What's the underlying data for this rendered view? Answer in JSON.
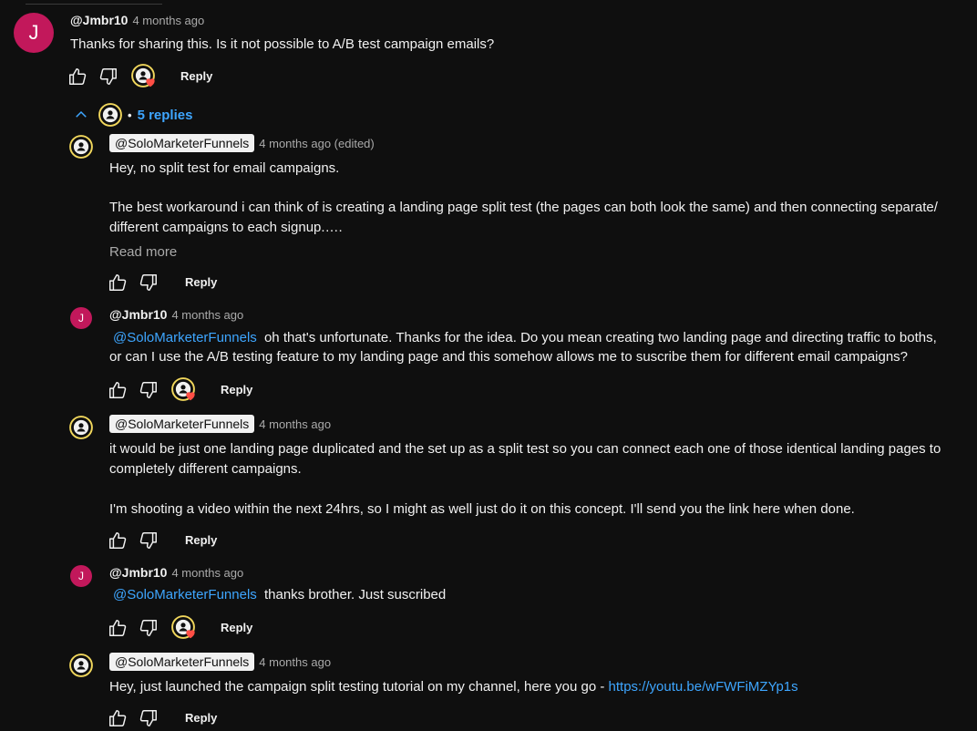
{
  "comment": {
    "avatar_letter": "J",
    "author": "@Jmbr10",
    "time": "4 months ago",
    "text": "Thanks for sharing this. Is it not possible to A/B test campaign emails?",
    "reply_label": "Reply"
  },
  "replies_toggle": {
    "dot": "•",
    "label": "5 replies"
  },
  "replies": [
    {
      "author": "@SoloMarketerFunnels",
      "time": "4 months ago (edited)",
      "line1": "Hey, no split test for email campaigns.",
      "line2": "The best workaround i can think of is creating a landing page split test (the pages can both look the same) and then connecting separate/",
      "line3": "different campaigns to each signup.….",
      "read_more": "Read more",
      "reply_label": "Reply"
    },
    {
      "avatar_letter": "J",
      "author": "@Jmbr10",
      "time": "4 months ago",
      "mention": "@SoloMarketerFunnels",
      "line1": "oh that's unfortunate. Thanks for the idea. Do you mean creating two landing page and directing traffic to boths,",
      "line2": "or can I use the A/B testing feature to my landing page and this somehow allows me to suscribe them for different email campaigns?",
      "reply_label": "Reply"
    },
    {
      "author": "@SoloMarketerFunnels",
      "time": "4 months ago",
      "line1": "it would be just one landing page duplicated and the set up as a split test so you can connect each one of those identical landing pages to",
      "line2": "completely different campaigns.",
      "line3": "I'm shooting a video within the next 24hrs, so I might as well just do it on this concept. I'll send you the link here when done.",
      "reply_label": "Reply"
    },
    {
      "avatar_letter": "J",
      "author": "@Jmbr10",
      "time": "4 months ago",
      "mention": "@SoloMarketerFunnels",
      "line1": "thanks brother. Just suscribed",
      "reply_label": "Reply"
    },
    {
      "author": "@SoloMarketerFunnels",
      "time": "4 months ago",
      "line1": "Hey, just launched the campaign split testing tutorial on my channel, here you go - ",
      "link": "https://youtu.be/wFWFiMZYp1s",
      "reply_label": "Reply"
    }
  ],
  "colors": {
    "background": "#0f0f0f",
    "text": "#f1f1f1",
    "muted": "#aaaaaa",
    "link": "#3ea6ff",
    "avatar": "#c2185b",
    "creator_ring": "#f1d75c",
    "heart": "#ff4e45"
  },
  "icons": [
    "thumbs-up-icon",
    "thumbs-down-icon",
    "creator-heart-icon",
    "chevron-up-icon",
    "creator-avatar-icon"
  ]
}
